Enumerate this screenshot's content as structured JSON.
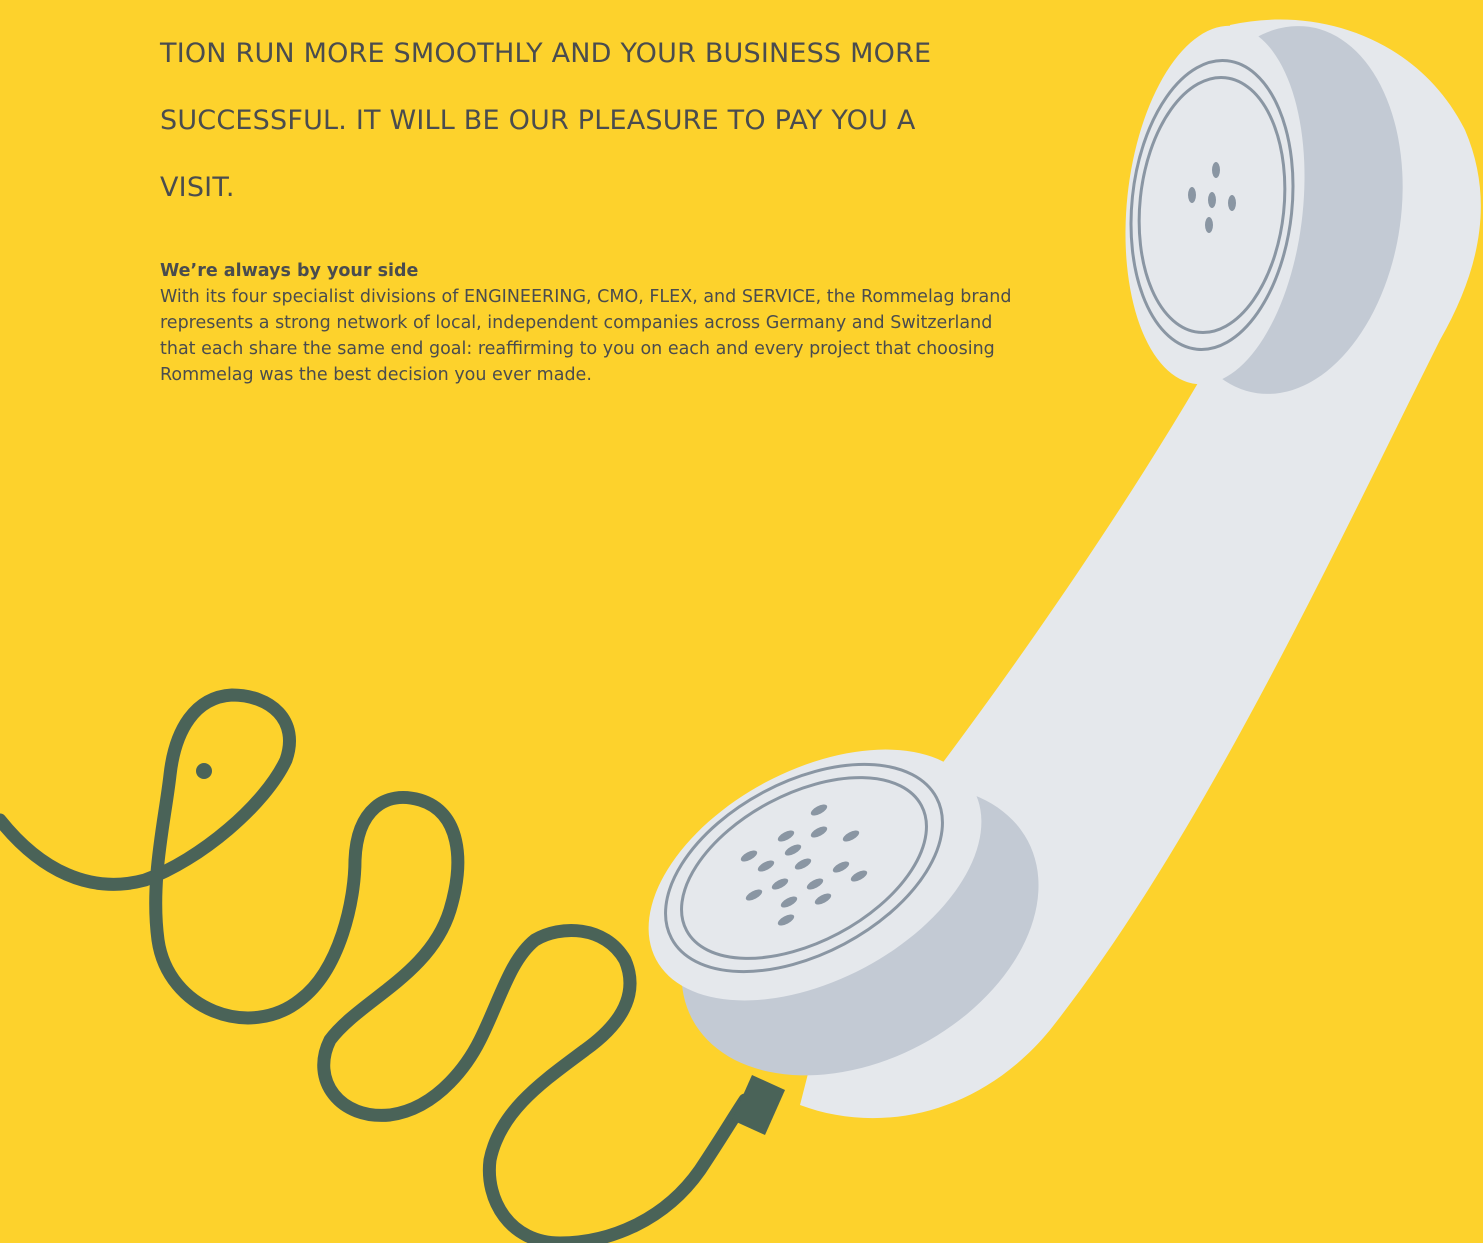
{
  "headline": {
    "lines": [
      "TION RUN MORE SMOOTHLY AND YOUR BUSINESS MORE",
      "SUCCESSFUL. IT WILL BE OUR PLEASURE TO PAY YOU A",
      "VISIT."
    ]
  },
  "section": {
    "subheading": "We’re always by your side",
    "body": "With its four specialist divisions of ENGINEERING, CMO, FLEX, and SERVICE, the Rommelag brand represents a strong network of local, independent companies across Germany and Switzerland that each share the same end goal: reaffirming to you on each and every project that choosing Rommelag was the best decision you ever made."
  },
  "illustration": {
    "subject": "telephone-handset-icon",
    "colors": {
      "background": "#fdd22c",
      "handset": "#e5e8ec",
      "handset_shadow": "#c3cad4",
      "ring": "#8a96a3",
      "cord": "#4a6358",
      "text": "#4a4c4e"
    }
  }
}
